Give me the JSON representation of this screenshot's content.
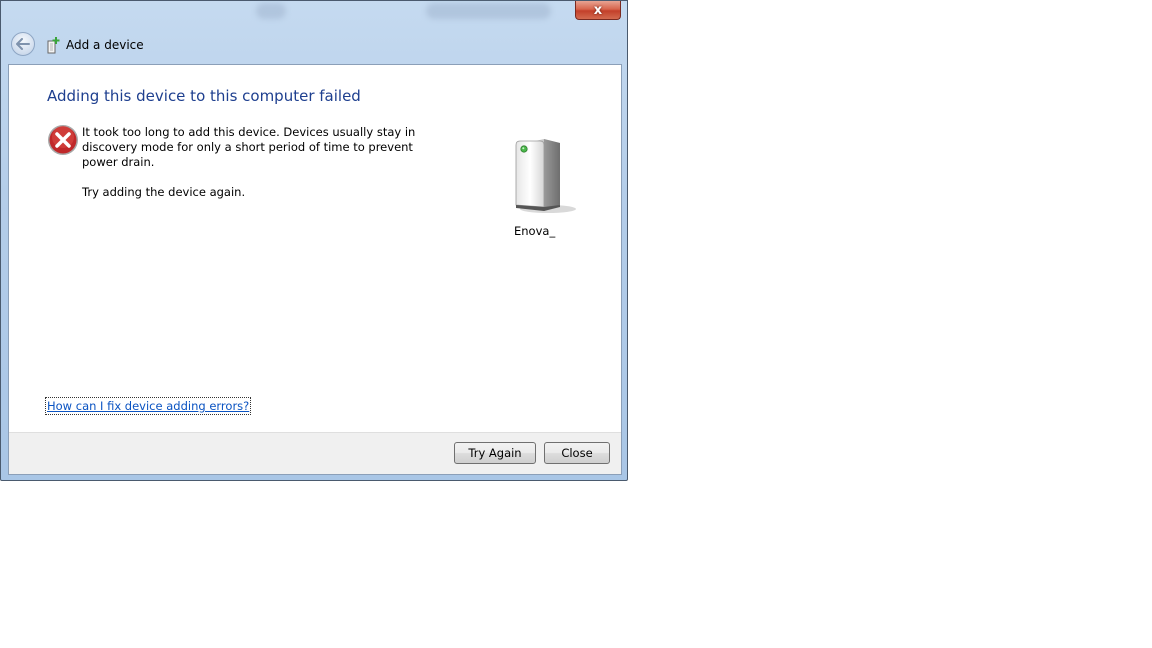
{
  "window": {
    "title": "Add a device",
    "close_glyph": "x"
  },
  "content": {
    "heading": "Adding this device to this computer failed",
    "message_line1": "It took too long to add this device. Devices usually stay in discovery mode for only a short period of time to prevent power drain.",
    "message_line2": "Try adding the device again.",
    "device_name": "Enova_",
    "help_link": "How can I fix device adding errors?"
  },
  "footer": {
    "try_again_label": "Try Again",
    "close_label": "Close"
  },
  "icons": {
    "error": "error-icon",
    "device": "storage-device-icon",
    "back": "back-arrow-icon",
    "add_device": "add-device-icon"
  },
  "colors": {
    "heading": "#1e3f8f",
    "link": "#0a53c2",
    "title_bar": "#b4cde9",
    "close_button": "#c3402a"
  }
}
